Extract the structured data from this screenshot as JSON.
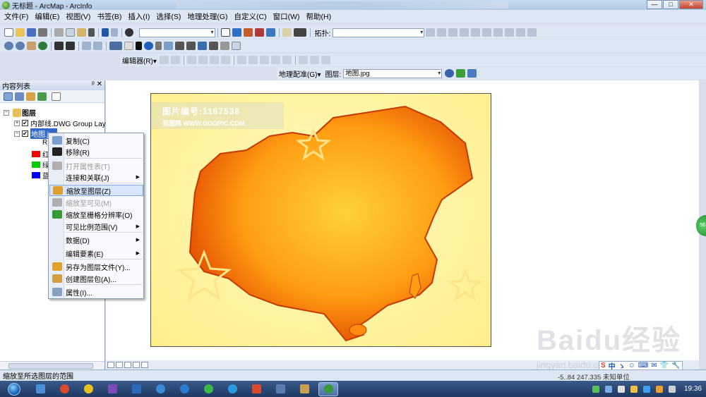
{
  "window": {
    "title": "无标题 - ArcMap - ArcInfo",
    "buttons": {
      "minimize": "—",
      "maximize": "□",
      "close": "✕"
    }
  },
  "menu": [
    "文件(F)",
    "编辑(E)",
    "视图(V)",
    "书签(B)",
    "插入(I)",
    "选择(S)",
    "地理处理(G)",
    "自定义(C)",
    "窗口(W)",
    "帮助(H)"
  ],
  "toolbars": {
    "topology_label": "拓扑:",
    "editor_label": "编辑器(R)▾",
    "georef_label": "地理配准(G)▾",
    "layer_label": "图层:",
    "layer_value": "地图.jpg"
  },
  "toc": {
    "header": "内容列表",
    "pins": "ᵖ ✕",
    "root": "图层",
    "layers": [
      {
        "name": "内部线.DWG Group Lay",
        "expand": "+"
      },
      {
        "name": "地图.jpg",
        "expand": "−"
      }
    ],
    "sub_label": "R",
    "legend": [
      {
        "label": "红",
        "color": "#ff0000"
      },
      {
        "label": "绿",
        "color": "#00cc00"
      },
      {
        "label": "蓝",
        "color": "#0000ff"
      }
    ]
  },
  "context_menu": {
    "items": [
      {
        "label": "复制(C)",
        "icon": "copy-icon",
        "disabled": false,
        "submenu": false,
        "selected": false
      },
      {
        "label": "移除(R)",
        "icon": "remove-icon",
        "disabled": false,
        "submenu": false,
        "selected": false
      },
      {
        "label": "打开属性表(T)",
        "icon": "table-icon",
        "disabled": true,
        "submenu": false,
        "selected": false
      },
      {
        "label": "连接和关联(J)",
        "icon": "",
        "disabled": false,
        "submenu": true,
        "selected": false
      },
      {
        "label": "缩放至图层(Z)",
        "icon": "zoom-layer-icon",
        "disabled": false,
        "submenu": false,
        "selected": true
      },
      {
        "label": "缩放至可见(M)",
        "icon": "zoom-visible-icon",
        "disabled": true,
        "submenu": false,
        "selected": false
      },
      {
        "label": "缩放至栅格分辨率(O)",
        "icon": "raster-resolution-icon",
        "disabled": false,
        "submenu": false,
        "selected": false
      },
      {
        "label": "可见比例范围(V)",
        "icon": "",
        "disabled": false,
        "submenu": true,
        "selected": false
      },
      {
        "label": "数据(D)",
        "icon": "",
        "disabled": false,
        "submenu": true,
        "selected": false
      },
      {
        "label": "编辑要素(E)",
        "icon": "",
        "disabled": false,
        "submenu": true,
        "selected": false
      },
      {
        "label": "另存为图层文件(Y)...",
        "icon": "save-layer-icon",
        "disabled": false,
        "submenu": false,
        "selected": false
      },
      {
        "label": "创建图层包(A)...",
        "icon": "layer-package-icon",
        "disabled": false,
        "submenu": false,
        "selected": false
      },
      {
        "label": "属性(I)...",
        "icon": "properties-icon",
        "disabled": false,
        "submenu": false,
        "selected": false
      }
    ],
    "submenu_arrow": "▶"
  },
  "map": {
    "watermark_line1": "图片编号:1167538",
    "watermark_line2": "我图网 WWW.OOOPIC.COM"
  },
  "status": {
    "message": "缩放至所选图层的范围",
    "coords": "-5..84  247.335 未知单位"
  },
  "overlay": {
    "baidu": "Baidu经验",
    "baidu_sub": "jingyan.baidu.com",
    "side_badge": "56"
  },
  "ime": [
    "S",
    "中",
    "ゝ",
    "☺",
    "⌨",
    "✉",
    "👕",
    "🔧"
  ],
  "taskbar": {
    "clock": "19:36"
  }
}
